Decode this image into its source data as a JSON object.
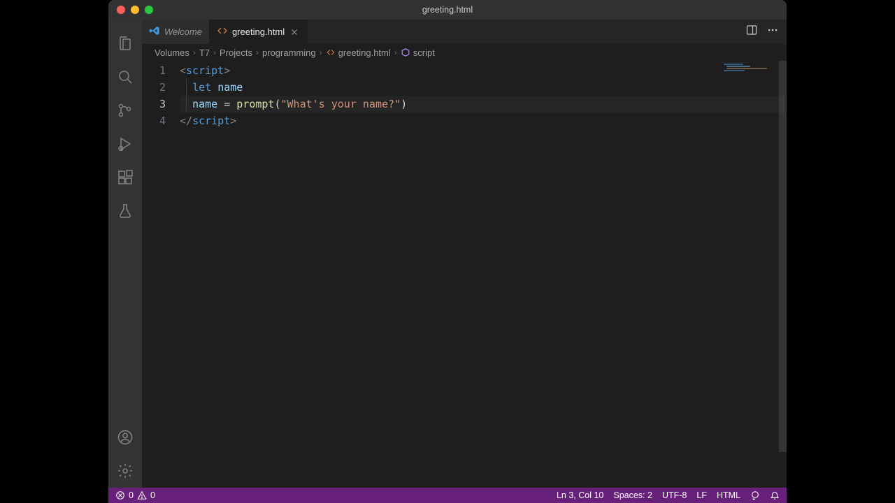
{
  "title": "greeting.html",
  "tabs": [
    {
      "label": "Welcome",
      "active": false
    },
    {
      "label": "greeting.html",
      "active": true
    }
  ],
  "breadcrumbs": {
    "parts": [
      "Volumes",
      "T7",
      "Projects",
      "programming"
    ],
    "file": "greeting.html",
    "symbol": "script"
  },
  "code": {
    "line_numbers": [
      "1",
      "2",
      "3",
      "4"
    ],
    "current_line_index": 2,
    "tokens": {
      "l1_open": "<",
      "l1_tag": "script",
      "l1_close": ">",
      "l2_kw": "let",
      "l2_var": "name",
      "l3_var": "name",
      "l3_eq": " = ",
      "l3_fn": "prompt",
      "l3_lp": "(",
      "l3_str": "\"What's your name?\"",
      "l3_rp": ")",
      "l4_open": "</",
      "l4_tag": "script",
      "l4_close": ">"
    }
  },
  "status": {
    "errors": "0",
    "warnings": "0",
    "cursor": "Ln 3, Col 10",
    "indent": "Spaces: 2",
    "encoding": "UTF-8",
    "eol": "LF",
    "lang": "HTML"
  }
}
